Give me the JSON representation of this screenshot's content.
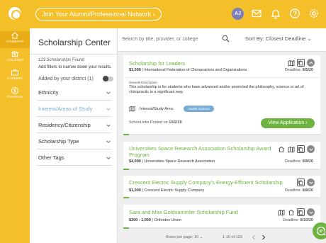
{
  "header": {
    "alumni_link": "Join Your Alumni/Professional Network",
    "avatar_initials": "AJ"
  },
  "nav": {
    "items": [
      {
        "label": "STUDENTS"
      },
      {
        "label": "COLLEGES"
      },
      {
        "label": "CAREERS"
      },
      {
        "label": "FINANCES"
      }
    ]
  },
  "filters": {
    "title": "Scholarship Center",
    "count_text": "123 Scholarships Found",
    "hint": "Add filters to narrow down your results.",
    "district_label": "Added by your district (1)",
    "items": [
      {
        "label": "Ethnicity"
      },
      {
        "label": "Interest/Areas of Study"
      },
      {
        "label": "Residency/Citizenship"
      },
      {
        "label": "Scholarship Type"
      },
      {
        "label": "Other Tags"
      }
    ]
  },
  "search": {
    "placeholder": "Search by title, provider, or college",
    "sort_label": "Sort By: Closest Deadline"
  },
  "scholarships": [
    {
      "title": "Scholarship for Leaders",
      "amount": "$1,000",
      "provider": "International Federation of Chiropractors and Organizations",
      "deadline_label": "Deadline:",
      "deadline": "8/5/20",
      "progress": 0.03,
      "desc_label": "General Description",
      "description": "This scholarship is for students who have advanced and/or promoted the philosophy, science or art of chiropractic in a significant way.",
      "study_label": "Interest/Study Area:",
      "study_tag": "Health Science",
      "posted_prefix": "SchooLinks Posted on",
      "posted_date": "10/2/19",
      "view_label": "View Application"
    },
    {
      "title": "Universities Space Research Association Scholarship Award Program",
      "amount": "$4,000",
      "provider": "Universities Space Research Association",
      "deadline_label": "Deadline:",
      "deadline": "8/8/20",
      "progress": 0.03
    },
    {
      "title": "Crescent Electric Supply Company's Energy Efficient Scholarship",
      "amount": "$1,000",
      "provider": "Crescent Electric Supply Company",
      "deadline_label": "Deadline:",
      "deadline": "8/8/20",
      "progress": 0.03
    },
    {
      "title": "Sara and Max Goldsammler Scholarship Fund",
      "amount": "$300 - 1,000",
      "provider": "Orthodox Union",
      "deadline_label": "Deadline:",
      "deadline": "8/10/20",
      "progress": 0.03
    }
  ],
  "pagination": {
    "rows_label": "Rows per page: 10",
    "range": "1-10 of 123"
  }
}
